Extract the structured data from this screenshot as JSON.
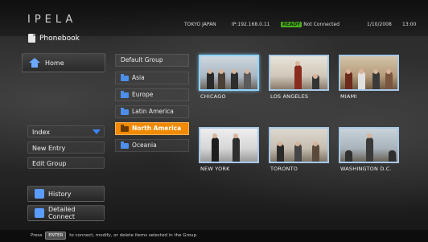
{
  "header": {
    "logo": "IPELA",
    "section": "Phonebook",
    "location": "TOKYO JAPAN",
    "ip": "IP:192.168.0.11",
    "ready_badge": "READY",
    "connection": "Not Connected",
    "date": "1/10/2008",
    "time": "13:00"
  },
  "nav": {
    "home_label": "Home",
    "index_label": "Index",
    "new_entry_label": "New Entry",
    "edit_group_label": "Edit Group",
    "history_label": "History",
    "detailed_connect_label": "Detailed Connect"
  },
  "groups": {
    "header_label": "Default Group",
    "items": [
      {
        "label": "Asia",
        "selected": false
      },
      {
        "label": "Europe",
        "selected": false
      },
      {
        "label": "Latin America",
        "selected": false
      },
      {
        "label": "North America",
        "selected": true
      },
      {
        "label": "Oceania",
        "selected": false
      }
    ]
  },
  "contacts": [
    {
      "label": "CHICAGO",
      "icon": "conference-room-photo"
    },
    {
      "label": "LOS ANGELES",
      "icon": "office-photo"
    },
    {
      "label": "MIAMI",
      "icon": "meeting-photo"
    },
    {
      "label": "NEW YORK",
      "icon": "office-photo"
    },
    {
      "label": "TORONTO",
      "icon": "conference-room-photo"
    },
    {
      "label": "WASHINGTON D.C.",
      "icon": "presentation-photo"
    }
  ],
  "help": {
    "prefix": "Press",
    "key": "ENTER",
    "text": "to connect, modify, or delete items selected in the Group."
  },
  "colors": {
    "accent_orange": "#f08a00",
    "ready_green": "#4caf22",
    "icon_blue": "#4d8ee8"
  }
}
